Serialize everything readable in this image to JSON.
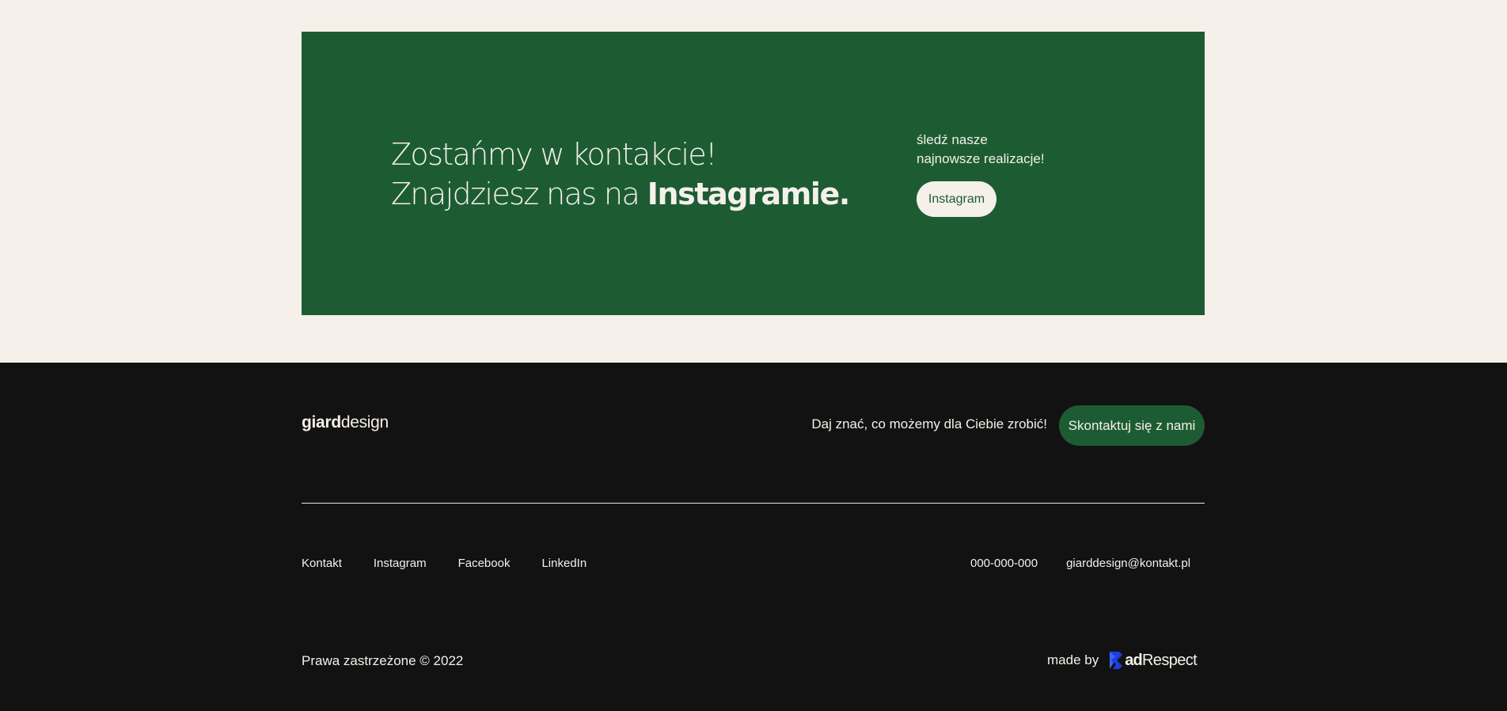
{
  "colors": {
    "background_light": "#f5f0ea",
    "brand_green": "#1d5c33",
    "footer_dark": "#121212",
    "adrespect_blue": "#1d3fe0"
  },
  "banner": {
    "headline_line1": "Zostańmy w kontakcie!",
    "headline_line2_prefix": "Znajdziesz nas na",
    "headline_line2_bold": "Instagramie.",
    "follow_line1": "śledź nasze",
    "follow_line2": "najnowsze realizacje!",
    "instagram_button": "Instagram"
  },
  "footer": {
    "logo_bold": "giard",
    "logo_regular": "design",
    "cta_text": "Daj znać, co możemy dla Ciebie zrobić!",
    "cta_button": "Skontaktuj się z nami",
    "links": [
      "Kontakt",
      "Instagram",
      "Facebook",
      "LinkedIn"
    ],
    "phone": "000-000-000",
    "email": "giarddesign@kontakt.pl",
    "copyright": "Prawa zastrzeżone © 2022",
    "made_by_label": "made by",
    "made_by_brand_bold": "ad",
    "made_by_brand_regular": "Respect",
    "made_by_icon": "adrespect-arrow-icon"
  }
}
